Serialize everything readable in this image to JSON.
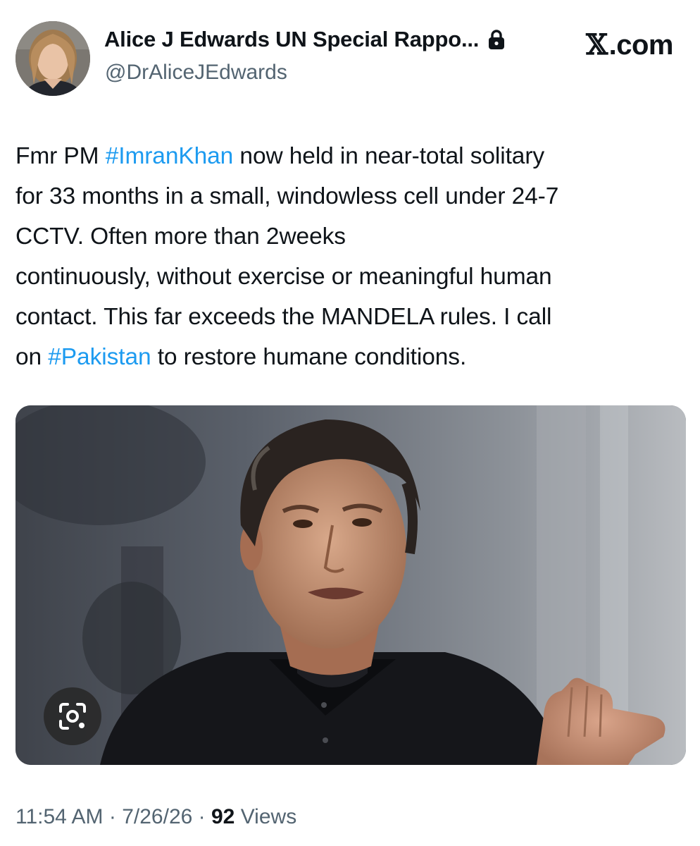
{
  "author": {
    "display_name": "Alice J Edwards UN Special Rappo...",
    "handle": "@DrAliceJEdwards",
    "avatar": "avatar-photo",
    "protected_icon": "lock-icon"
  },
  "site": {
    "label_glyph": "𝕏",
    "label_text": ".com"
  },
  "post": {
    "line1_before": "Fmr PM ",
    "line1_hashtag": "#ImranKhan",
    "line1_after": " now held in near-total solitary",
    "line2": "for 33 months in a small, windowless cell under 24-7",
    "line3": "CCTV. Often more than 2weeks",
    "line4": "continuously, without exercise or meaningful human",
    "line5": "contact. This far exceeds the MANDELA rules. I call",
    "line6_before": "on ",
    "line6_hashtag": "#Pakistan",
    "line6_after": " to restore humane conditions."
  },
  "media": {
    "image": "photo-of-man-speaking",
    "lens_icon": "visual-search-icon"
  },
  "meta": {
    "time": "11:54 AM",
    "separator": "·",
    "date": "7/26/26",
    "views_count": "92",
    "views_label": "Views"
  },
  "colors": {
    "hashtag": "#1d9bf0",
    "text": "#0f1419",
    "secondary": "#536471"
  }
}
